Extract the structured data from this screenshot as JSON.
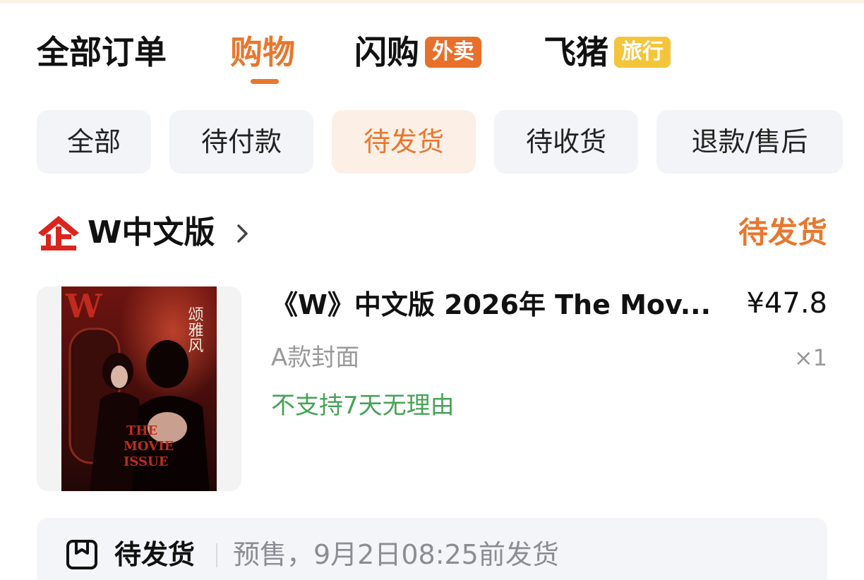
{
  "main_tabs": [
    {
      "label": "全部订单",
      "active": false
    },
    {
      "label": "购物",
      "active": true
    },
    {
      "label": "闪购",
      "badge": "外卖",
      "active": false
    },
    {
      "label": "飞猪",
      "badge": "旅行",
      "active": false
    }
  ],
  "sub_tabs": [
    {
      "label": "全部",
      "active": false
    },
    {
      "label": "待付款",
      "active": false
    },
    {
      "label": "待发货",
      "active": true
    },
    {
      "label": "待收货",
      "active": false
    },
    {
      "label": "退款/售后",
      "active": false
    }
  ],
  "order": {
    "shop_logo_text": "企",
    "shop_name": "W中文版",
    "status": "待发货",
    "product": {
      "title": "《W》中文版 2026年 The Mov...",
      "price": "¥47.8",
      "variant": "A款封面",
      "quantity": "×1",
      "policy": "不支持7天无理由",
      "cover": {
        "masthead": "W",
        "vertical_title": "颂雅风",
        "headline_lines": [
          "THE",
          "MOVIE",
          "ISSUE"
        ]
      }
    },
    "shipping": {
      "label": "待发货",
      "note": "预售，9月2日08:25前发货"
    }
  },
  "colors": {
    "accent": "#e8772e",
    "policy_green": "#45a356",
    "tag_orange": "#e8702a",
    "tag_yellow": "#f4c53a",
    "chip_bg": "#f2f4f7",
    "chip_active_bg": "#fcefe6"
  },
  "icons": {
    "shop_logo": "enterprise-shop-icon",
    "shop_chevron": "chevron-right-icon",
    "shipping": "package-box-icon"
  }
}
